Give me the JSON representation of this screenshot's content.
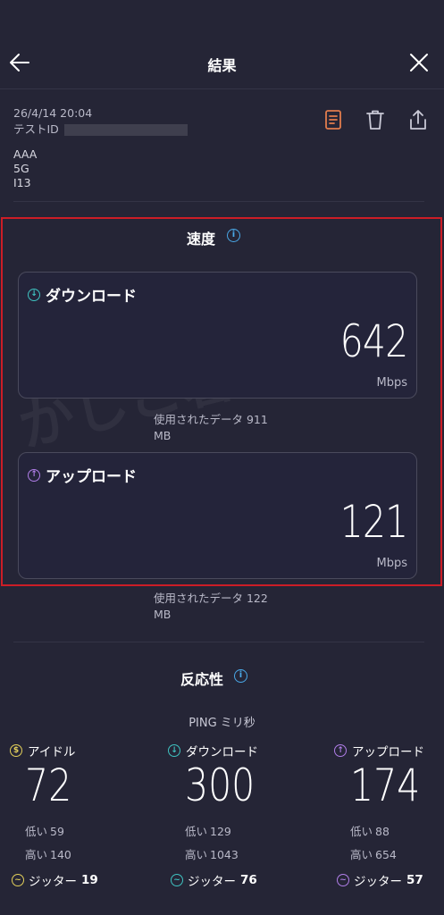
{
  "header": {
    "title": "結果",
    "back_icon": "arrow-left-icon",
    "close_icon": "close-icon"
  },
  "meta": {
    "datetime": "26/4/14 20:04",
    "test_id_label": "テストID",
    "carrier": "AAA",
    "network": "5G",
    "device": "I13"
  },
  "actions": [
    {
      "name": "report-icon",
      "color": "#e27c4d"
    },
    {
      "name": "trash-icon",
      "color": "#c9c9d6"
    },
    {
      "name": "share-icon",
      "color": "#c9c9d6"
    }
  ],
  "speed": {
    "title": "速度",
    "download": {
      "label": "ダウンロード",
      "value": "642",
      "unit": "Mbps",
      "data_used": "使用されたデータ 911 MB"
    },
    "upload": {
      "label": "アップロード",
      "value": "121",
      "unit": "Mbps",
      "data_used": "使用されたデータ 122 MB"
    }
  },
  "watermark": "かしこ暮らし",
  "responsiveness": {
    "title": "反応性",
    "ping_label": "PING ミリ秒",
    "columns": [
      {
        "label": "アイドル",
        "value": "72",
        "low_label": "低い",
        "low": "59",
        "high_label": "高い",
        "high": "140",
        "jitter_label": "ジッター",
        "jitter": "19",
        "color": "#e3d05a"
      },
      {
        "label": "ダウンロード",
        "value": "300",
        "low_label": "低い",
        "low": "129",
        "high_label": "高い",
        "high": "1043",
        "jitter_label": "ジッター",
        "jitter": "76",
        "color": "#3fc3c1"
      },
      {
        "label": "アップロード",
        "value": "174",
        "low_label": "低い",
        "low": "88",
        "high_label": "高い",
        "high": "654",
        "jitter_label": "ジッター",
        "jitter": "57",
        "color": "#b07ee8"
      }
    ]
  },
  "colors": {
    "background": "#252536",
    "highlight_border": "#cc1d26",
    "info": "#4aa9e8"
  }
}
